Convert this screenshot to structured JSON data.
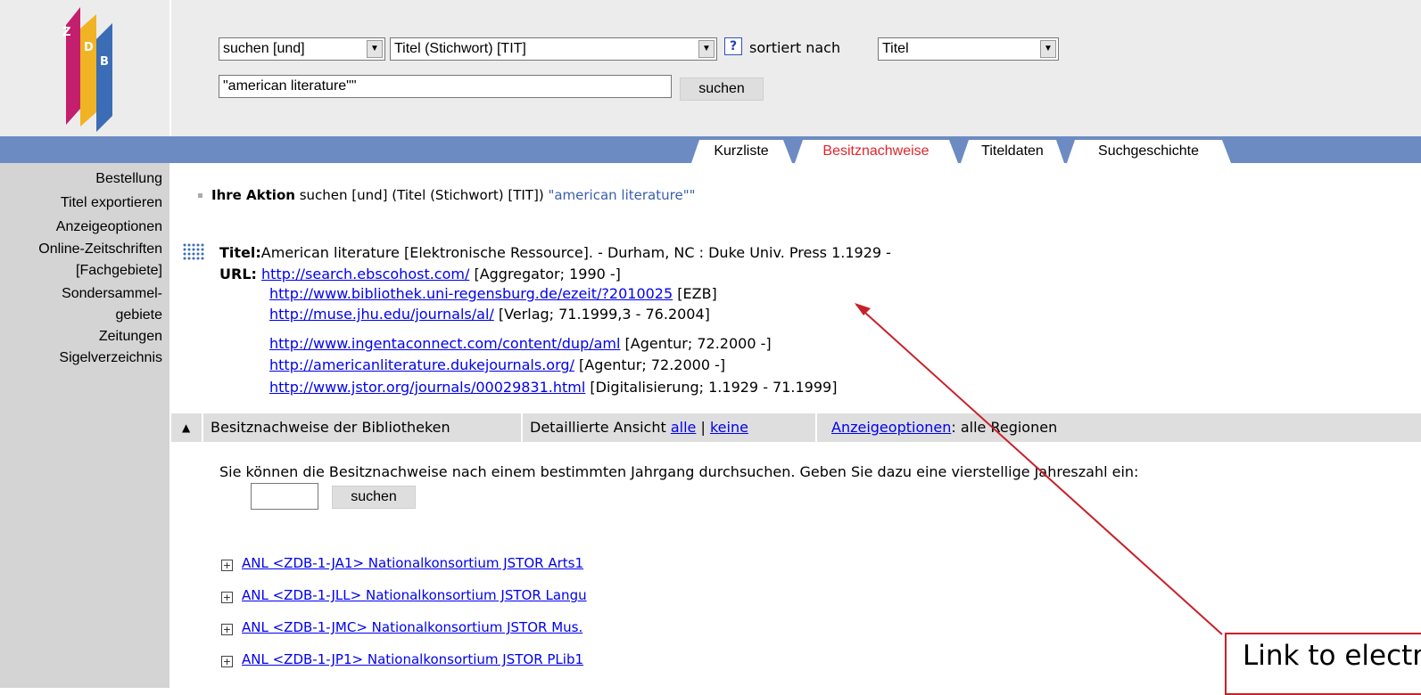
{
  "header": {
    "logo_alt": "ZDB",
    "search_mode": "suchen [und]",
    "search_field": "Titel (Stichwort) [TIT]",
    "help_glyph": "?",
    "sort_label": "sortiert nach",
    "sort_value": "Titel",
    "search_value": "\"american literature\"\"",
    "search_button": "suchen"
  },
  "tabs": [
    {
      "label": "Kurzliste",
      "active": false
    },
    {
      "label": "Besitznachweise",
      "active": true
    },
    {
      "label": "Titeldaten",
      "active": false
    },
    {
      "label": "Suchgeschichte",
      "active": false
    }
  ],
  "sidebar": [
    "Bestellung",
    "Titel exportieren",
    "Anzeigeoptionen",
    "Online-Zeitschriften",
    "[Fachgebiete]",
    "Sondersammel-",
    "gebiete",
    "Zeitungen",
    "Sigelverzeichnis"
  ],
  "action": {
    "label": "Ihre Aktion",
    "text": "suchen [und] (Titel (Stichwort) [TIT])",
    "query": "\"american literature\"\""
  },
  "record": {
    "title_label": "Titel:",
    "title_text": "American literature [Elektronische Ressource]. - Durham, NC : Duke Univ. Press   1.1929 -",
    "url_label": "URL:",
    "urls": [
      {
        "href": "http://search.ebscohost.com/",
        "note": "[Aggregator; 1990 -]"
      },
      {
        "href": "http://www.bibliothek.uni-regensburg.de/ezeit/?2010025",
        "note": "[EZB]"
      },
      {
        "href": "http://muse.jhu.edu/journals/al/",
        "note": "[Verlag; 71.1999,3 - 76.2004]"
      },
      {
        "href": "http://www.ingentaconnect.com/content/dup/aml",
        "note": "[Agentur; 72.2000 -]"
      },
      {
        "href": "http://americanliterature.dukejournals.org/",
        "note": "[Agentur; 72.2000 -]"
      },
      {
        "href": "http://www.jstor.org/journals/00029831.html",
        "note": "[Digitalisierung; 1.1929 - 71.1999]"
      }
    ]
  },
  "holdings": {
    "toggle_glyph": "▲",
    "title": "Besitznachweise der Bibliotheken",
    "detail_label": "Detaillierte Ansicht",
    "all_link": "alle",
    "separator": "|",
    "none_link": "keine",
    "options_link": "Anzeigeoptionen",
    "options_suffix": ": alle Regionen",
    "year_prompt": "Sie können die Besitznachweise nach einem bestimmten Jahrgang durchsuchen. Geben Sie dazu eine vierstellige Jahreszahl ein:",
    "year_value": "",
    "year_button": "suchen",
    "libraries": [
      "ANL <ZDB-1-JA1> Nationalkonsortium JSTOR Arts1",
      "ANL <ZDB-1-JLL> Nationalkonsortium JSTOR Langu",
      "ANL <ZDB-1-JMC> Nationalkonsortium JSTOR Mus.",
      "ANL <ZDB-1-JP1> Nationalkonsortium JSTOR PLib1"
    ]
  },
  "annotation": {
    "text": "Link to electronic",
    "color": "#c8202a"
  },
  "colors": {
    "tabbar": "#6c8bc3",
    "active_tab": "#e0252b",
    "sidebar": "#d4d4d4",
    "header": "#ececec"
  }
}
